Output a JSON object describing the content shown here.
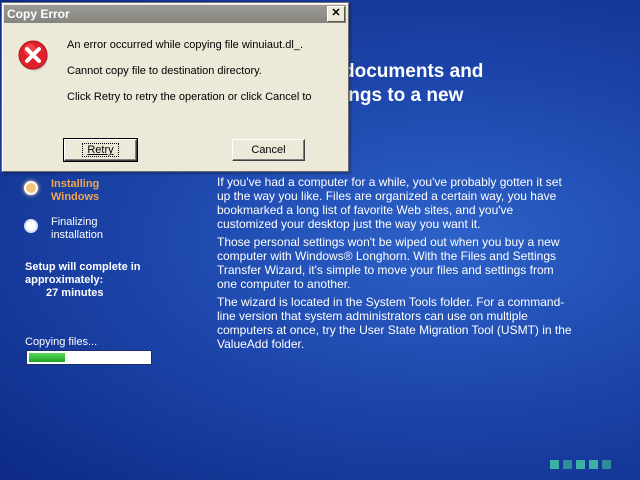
{
  "setup": {
    "heading": "documents and\nings to a new",
    "steps": [
      {
        "label": "Installing Windows",
        "state": "active"
      },
      {
        "label": "Finalizing installation",
        "state": "pending"
      }
    ],
    "estimate_label": "Setup will complete in approximately:",
    "estimate_value": "27 minutes",
    "copy_label": "Copying files...",
    "progress_fraction": 0.3,
    "paragraphs": [
      "If you've had a computer for a while, you've probably gotten it set up the way you like. Files are organized a certain way, you have bookmarked a long list of favorite Web sites, and you've customized your desktop just the way you want it.",
      "Those personal settings won't be wiped out when you buy a new computer with Windows® Longhorn. With the Files and Settings Transfer Wizard, it's simple to move your files and settings from one computer to another.",
      "The wizard is located in the System Tools folder. For a command-line version that system administrators can use on multiple computers at once, try the User State Migration Tool (USMT) in the ValueAdd folder."
    ]
  },
  "dialog": {
    "title": "Copy Error",
    "close_glyph": "✕",
    "messages": [
      "An error occurred while copying file winuiaut.dl_.",
      "Cannot copy file to destination directory.",
      "Click Retry to retry the operation or click Cancel to"
    ],
    "retry_label": "Retry",
    "cancel_label": "Cancel",
    "icon": "error-icon"
  }
}
